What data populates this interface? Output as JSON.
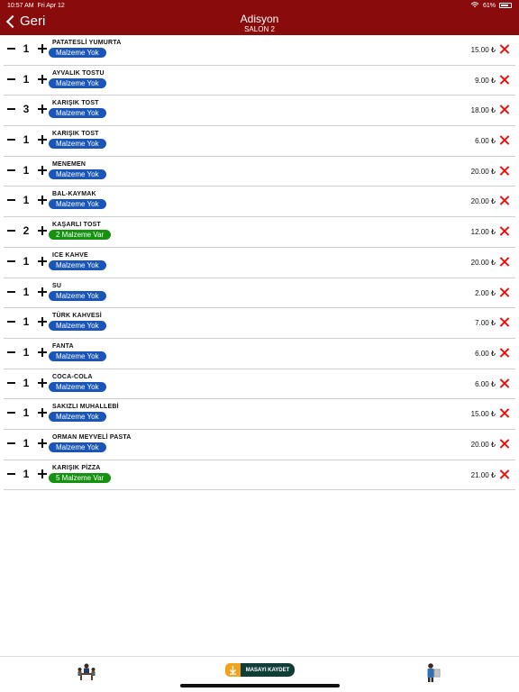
{
  "status": {
    "time": "10:57 AM",
    "date": "Fri Apr 12",
    "battery": "61%"
  },
  "nav": {
    "back_label": "Geri",
    "title": "Adisyon",
    "subtitle": "SALON 2"
  },
  "items": [
    {
      "qty": "1",
      "name": "PATATESLİ YUMURTA",
      "badge": "Malzeme Yok",
      "badge_type": "blue",
      "price": "15.00 ₺"
    },
    {
      "qty": "1",
      "name": "AYVALIK TOSTU",
      "badge": "Malzeme Yok",
      "badge_type": "blue",
      "price": "9.00 ₺"
    },
    {
      "qty": "3",
      "name": "KARIŞIK TOST",
      "badge": "Malzeme Yok",
      "badge_type": "blue",
      "price": "18.00 ₺"
    },
    {
      "qty": "1",
      "name": "KARIŞIK TOST",
      "badge": "Malzeme Yok",
      "badge_type": "blue",
      "price": "6.00 ₺"
    },
    {
      "qty": "1",
      "name": "MENEMEN",
      "badge": "Malzeme Yok",
      "badge_type": "blue",
      "price": "20.00 ₺"
    },
    {
      "qty": "1",
      "name": "BAL-KAYMAK",
      "badge": "Malzeme Yok",
      "badge_type": "blue",
      "price": "20.00 ₺"
    },
    {
      "qty": "2",
      "name": "KAŞARLI TOST",
      "badge": "2 Malzeme Var",
      "badge_type": "green",
      "price": "12.00 ₺"
    },
    {
      "qty": "1",
      "name": "ICE KAHVE",
      "badge": "Malzeme Yok",
      "badge_type": "blue",
      "price": "20.00 ₺"
    },
    {
      "qty": "1",
      "name": "SU",
      "badge": "Malzeme Yok",
      "badge_type": "blue",
      "price": "2.00 ₺"
    },
    {
      "qty": "1",
      "name": "TÜRK KAHVESİ",
      "badge": "Malzeme Yok",
      "badge_type": "blue",
      "price": "7.00 ₺"
    },
    {
      "qty": "1",
      "name": "FANTA",
      "badge": "Malzeme Yok",
      "badge_type": "blue",
      "price": "6.00 ₺"
    },
    {
      "qty": "1",
      "name": "COCA-COLA",
      "badge": "Malzeme Yok",
      "badge_type": "blue",
      "price": "6.00 ₺"
    },
    {
      "qty": "1",
      "name": "SAKIZLI MUHALLEBİ",
      "badge": "Malzeme Yok",
      "badge_type": "blue",
      "price": "15.00 ₺"
    },
    {
      "qty": "1",
      "name": "ORMAN MEYVELİ PASTA",
      "badge": "Malzeme Yok",
      "badge_type": "blue",
      "price": "20.00 ₺"
    },
    {
      "qty": "1",
      "name": "KARIŞIK PİZZA",
      "badge": "5 Malzeme Var",
      "badge_type": "green",
      "price": "21.00 ₺"
    }
  ],
  "bottom": {
    "left_icon": "waiter-table-icon",
    "save_label": "MASAYI KAYDET",
    "save_icon": "download-icon",
    "right_icon": "waiter-menu-icon"
  },
  "colors": {
    "header": "#8a0b0b",
    "badge_blue": "#1a55b8",
    "badge_green": "#15920f",
    "delete": "#e8100a",
    "save_bg": "#0f3e37",
    "save_icon_bg": "#f3a21b"
  }
}
